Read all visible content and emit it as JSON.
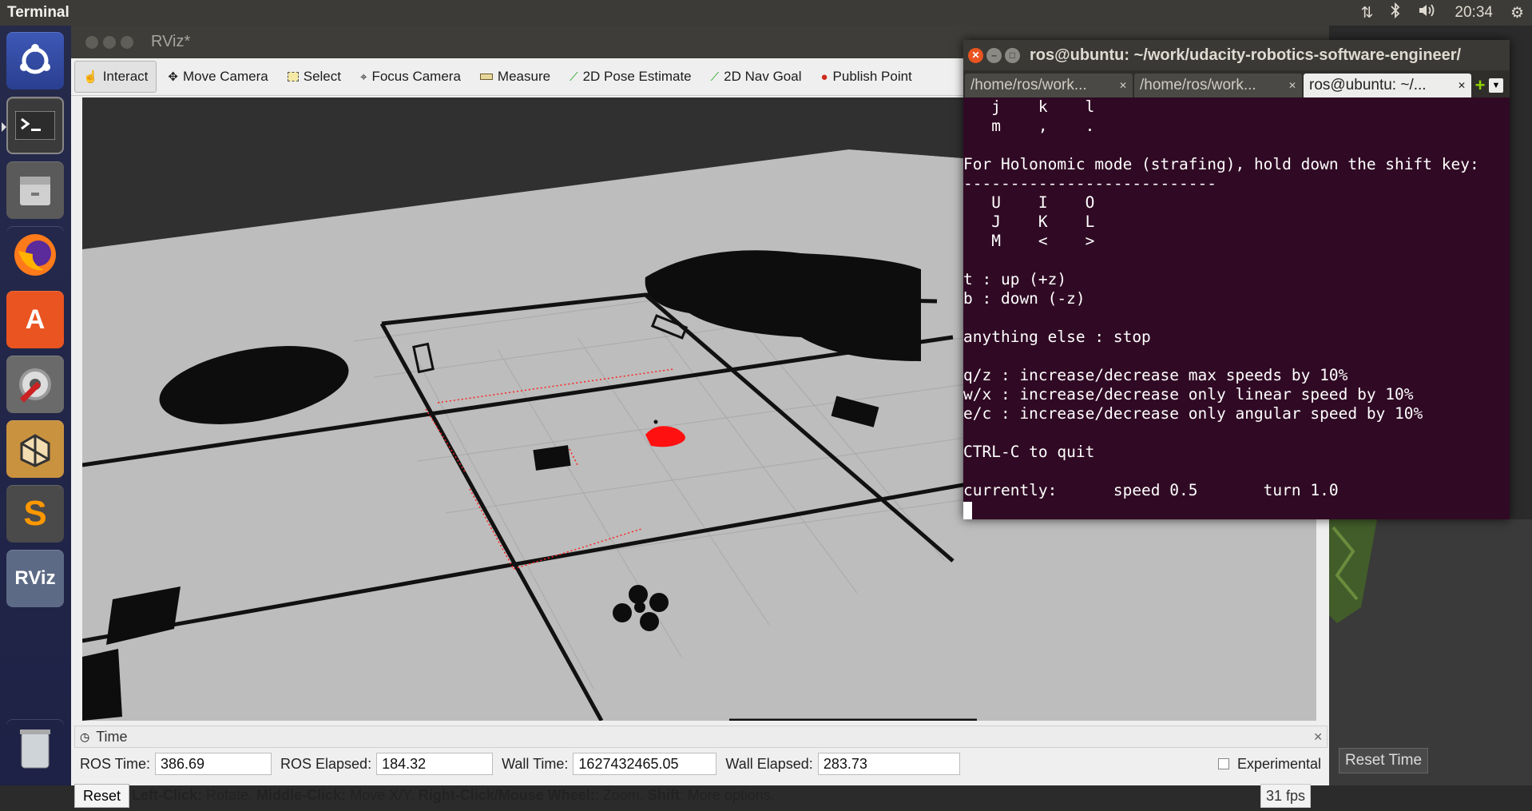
{
  "topbar": {
    "app_title": "Terminal",
    "clock": "20:34",
    "indicators": [
      "network-icon",
      "bluetooth-icon",
      "volume-icon",
      "settings-gear-icon"
    ]
  },
  "launcher": {
    "items": [
      {
        "name": "ubuntu-dash",
        "icon": "ubuntu-icon"
      },
      {
        "name": "terminal",
        "icon": "terminal-icon"
      },
      {
        "name": "files",
        "icon": "file-cabinet-icon"
      },
      {
        "name": "firefox",
        "icon": "firefox-icon"
      },
      {
        "name": "software-center",
        "icon": "shopping-bag-icon"
      },
      {
        "name": "system-settings",
        "icon": "wrench-gear-icon"
      },
      {
        "name": "virtualbox",
        "icon": "box-icon"
      },
      {
        "name": "sublime-text",
        "icon": "sublime-icon",
        "label": "S"
      },
      {
        "name": "rviz",
        "icon": "rviz-icon",
        "label": "RViz"
      },
      {
        "name": "trash",
        "icon": "trash-icon"
      }
    ]
  },
  "rviz": {
    "title": "RViz*",
    "toolbar": [
      {
        "label": "Interact",
        "icon": "hand-cursor-icon",
        "active": true
      },
      {
        "label": "Move Camera",
        "icon": "move-camera-icon"
      },
      {
        "label": "Select",
        "icon": "select-box-icon"
      },
      {
        "label": "Focus Camera",
        "icon": "crosshair-icon"
      },
      {
        "label": "Measure",
        "icon": "ruler-icon"
      },
      {
        "label": "2D Pose Estimate",
        "icon": "green-arrow-icon"
      },
      {
        "label": "2D Nav Goal",
        "icon": "green-arrow-icon"
      },
      {
        "label": "Publish Point",
        "icon": "map-pin-icon"
      }
    ],
    "time_panel": {
      "header": "Time",
      "ros_time_label": "ROS Time:",
      "ros_time": "386.69",
      "ros_elapsed_label": "ROS Elapsed:",
      "ros_elapsed": "184.32",
      "wall_time_label": "Wall Time:",
      "wall_time": "1627432465.05",
      "wall_elapsed_label": "Wall Elapsed:",
      "wall_elapsed": "283.73",
      "experimental_label": "Experimental"
    },
    "status": {
      "reset_label": "Reset",
      "left_click": "Left-Click:",
      "left_click_text": " Rotate. ",
      "middle_click": "Middle-Click:",
      "middle_click_text": " Move X/Y. ",
      "right_click": "Right-Click/Mouse Wheel:",
      "right_click_text": ": Zoom. ",
      "shift": "Shift",
      "shift_text": ": More options.",
      "fps": "31 fps",
      "reset_time_label": "Reset Time"
    }
  },
  "terminal": {
    "title": "ros@ubuntu: ~/work/udacity-robotics-software-engineer/",
    "tabs": [
      {
        "label": "/home/ros/work...",
        "active": false
      },
      {
        "label": "/home/ros/work...",
        "active": false
      },
      {
        "label": "ros@ubuntu: ~/...",
        "active": true
      }
    ],
    "lines": [
      "   j    k    l",
      "   m    ,    .",
      "",
      "For Holonomic mode (strafing), hold down the shift key:",
      "---------------------------",
      "   U    I    O",
      "   J    K    L",
      "   M    <    >",
      "",
      "t : up (+z)",
      "b : down (-z)",
      "",
      "anything else : stop",
      "",
      "q/z : increase/decrease max speeds by 10%",
      "w/x : increase/decrease only linear speed by 10%",
      "e/c : increase/decrease only angular speed by 10%",
      "",
      "CTRL-C to quit",
      "",
      "currently:      speed 0.5       turn 1.0"
    ]
  },
  "colors": {
    "terminal_bg": "#300a24",
    "launcher_bg": "#262a4b",
    "panel_bg": "#3c3b37",
    "laser_scan": "#ff0000"
  }
}
